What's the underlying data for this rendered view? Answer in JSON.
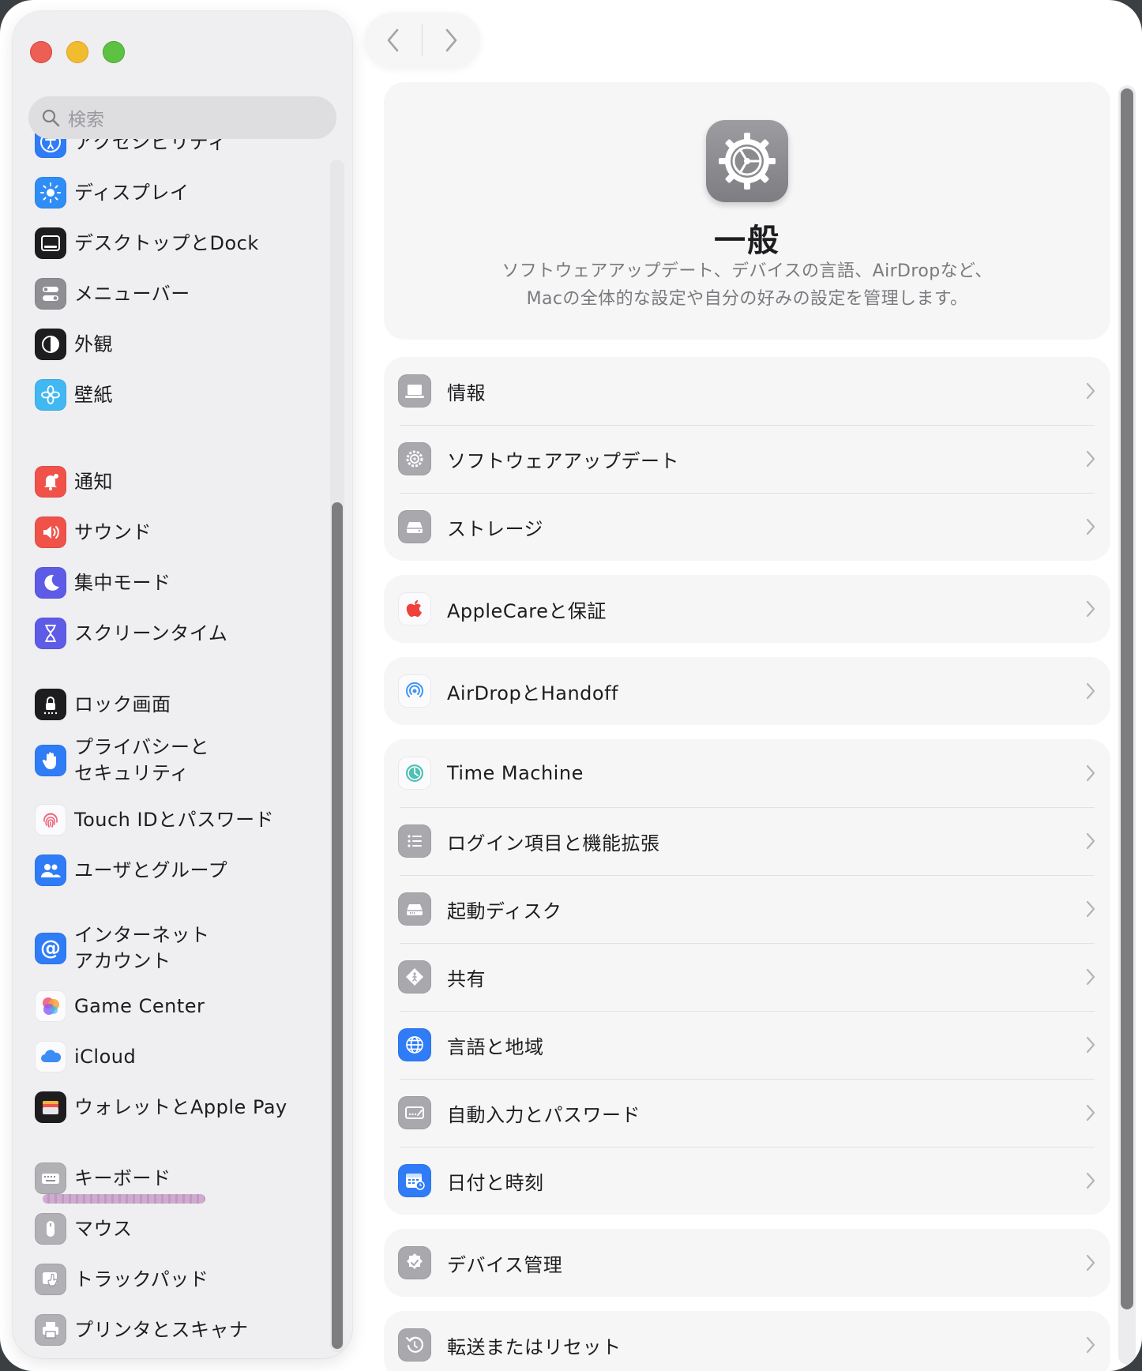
{
  "search": {
    "placeholder": "検索"
  },
  "sidebar": {
    "items": [
      {
        "label": "アクセシビリティ",
        "icon": "accessibility-icon"
      },
      {
        "label": "ディスプレイ",
        "icon": "display-icon"
      },
      {
        "label": "デスクトップとDock",
        "icon": "desktop-dock-icon"
      },
      {
        "label": "メニューバー",
        "icon": "menubar-icon"
      },
      {
        "label": "外観",
        "icon": "appearance-icon"
      },
      {
        "label": "壁紙",
        "icon": "wallpaper-icon"
      },
      {
        "label": "通知",
        "icon": "notifications-icon"
      },
      {
        "label": "サウンド",
        "icon": "sound-icon"
      },
      {
        "label": "集中モード",
        "icon": "focus-icon"
      },
      {
        "label": "スクリーンタイム",
        "icon": "screen-time-icon"
      },
      {
        "label": "ロック画面",
        "icon": "lock-screen-icon"
      },
      {
        "label": "プライバシーと\nセキュリティ",
        "icon": "privacy-icon"
      },
      {
        "label": "Touch IDとパスワード",
        "icon": "touch-id-icon"
      },
      {
        "label": "ユーザとグループ",
        "icon": "users-groups-icon"
      },
      {
        "label": "インターネット\nアカウント",
        "icon": "internet-accounts-icon"
      },
      {
        "label": "Game Center",
        "icon": "game-center-icon"
      },
      {
        "label": "iCloud",
        "icon": "icloud-icon"
      },
      {
        "label": "ウォレットとApple Pay",
        "icon": "wallet-icon"
      },
      {
        "label": "キーボード",
        "icon": "keyboard-icon"
      },
      {
        "label": "マウス",
        "icon": "mouse-icon"
      },
      {
        "label": "トラックパッド",
        "icon": "trackpad-icon"
      },
      {
        "label": "プリンタとスキャナ",
        "icon": "printer-icon"
      }
    ]
  },
  "header": {
    "title": "一般",
    "description": "ソフトウェアアップデート、デバイスの言語、AirDropなど、\nMacの全体的な設定や自分の好みの設定を管理します。",
    "icon": "gear-icon"
  },
  "groups": [
    {
      "rows": [
        {
          "label": "情報",
          "icon": "laptop-icon"
        },
        {
          "label": "ソフトウェアアップデート",
          "icon": "software-update-icon"
        },
        {
          "label": "ストレージ",
          "icon": "storage-icon"
        }
      ]
    },
    {
      "rows": [
        {
          "label": "AppleCareと保証",
          "icon": "apple-icon"
        }
      ]
    },
    {
      "rows": [
        {
          "label": "AirDropとHandoff",
          "icon": "airdrop-icon"
        }
      ]
    },
    {
      "rows": [
        {
          "label": "Time Machine",
          "icon": "time-machine-icon"
        },
        {
          "label": "ログイン項目と機能拡張",
          "icon": "login-items-icon"
        },
        {
          "label": "起動ディスク",
          "icon": "startup-disk-icon"
        },
        {
          "label": "共有",
          "icon": "sharing-icon"
        },
        {
          "label": "言語と地域",
          "icon": "globe-icon"
        },
        {
          "label": "自動入力とパスワード",
          "icon": "autofill-icon"
        },
        {
          "label": "日付と時刻",
          "icon": "calendar-clock-icon"
        }
      ]
    },
    {
      "rows": [
        {
          "label": "デバイス管理",
          "icon": "device-management-icon"
        }
      ]
    },
    {
      "rows": [
        {
          "label": "転送またはリセット",
          "icon": "reset-icon"
        }
      ]
    }
  ]
}
